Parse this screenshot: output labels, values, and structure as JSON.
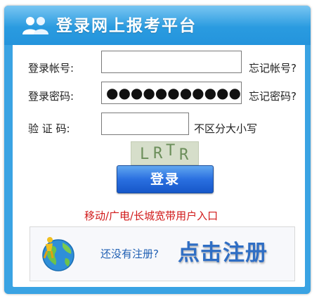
{
  "header": {
    "title": "登录网上报考平台",
    "icon": "users-icon"
  },
  "form": {
    "account_label": "登录帐号:",
    "account_value": "",
    "forgot_account": "忘记帐号?",
    "password_label": "登录密码:",
    "password_mask": "●●●●●●●●●●●●●●●●",
    "forgot_password": "忘记密码?",
    "captcha_label": "验 证 码:",
    "captcha_value": "",
    "captcha_hint": "不区分大小写",
    "captcha_text": [
      "L",
      "R",
      "T",
      "R"
    ],
    "login_button": "登录"
  },
  "mobile_link": "移动/广电/长城宽带用户入口",
  "register": {
    "question": "还没有注册?",
    "cta": "点击注册",
    "icon": "globe-person-icon"
  },
  "colors": {
    "header_blue": "#2a9be0",
    "button_blue": "#2a6fe0",
    "link_red": "#d11a1a",
    "register_blue": "#2f6ec4"
  }
}
